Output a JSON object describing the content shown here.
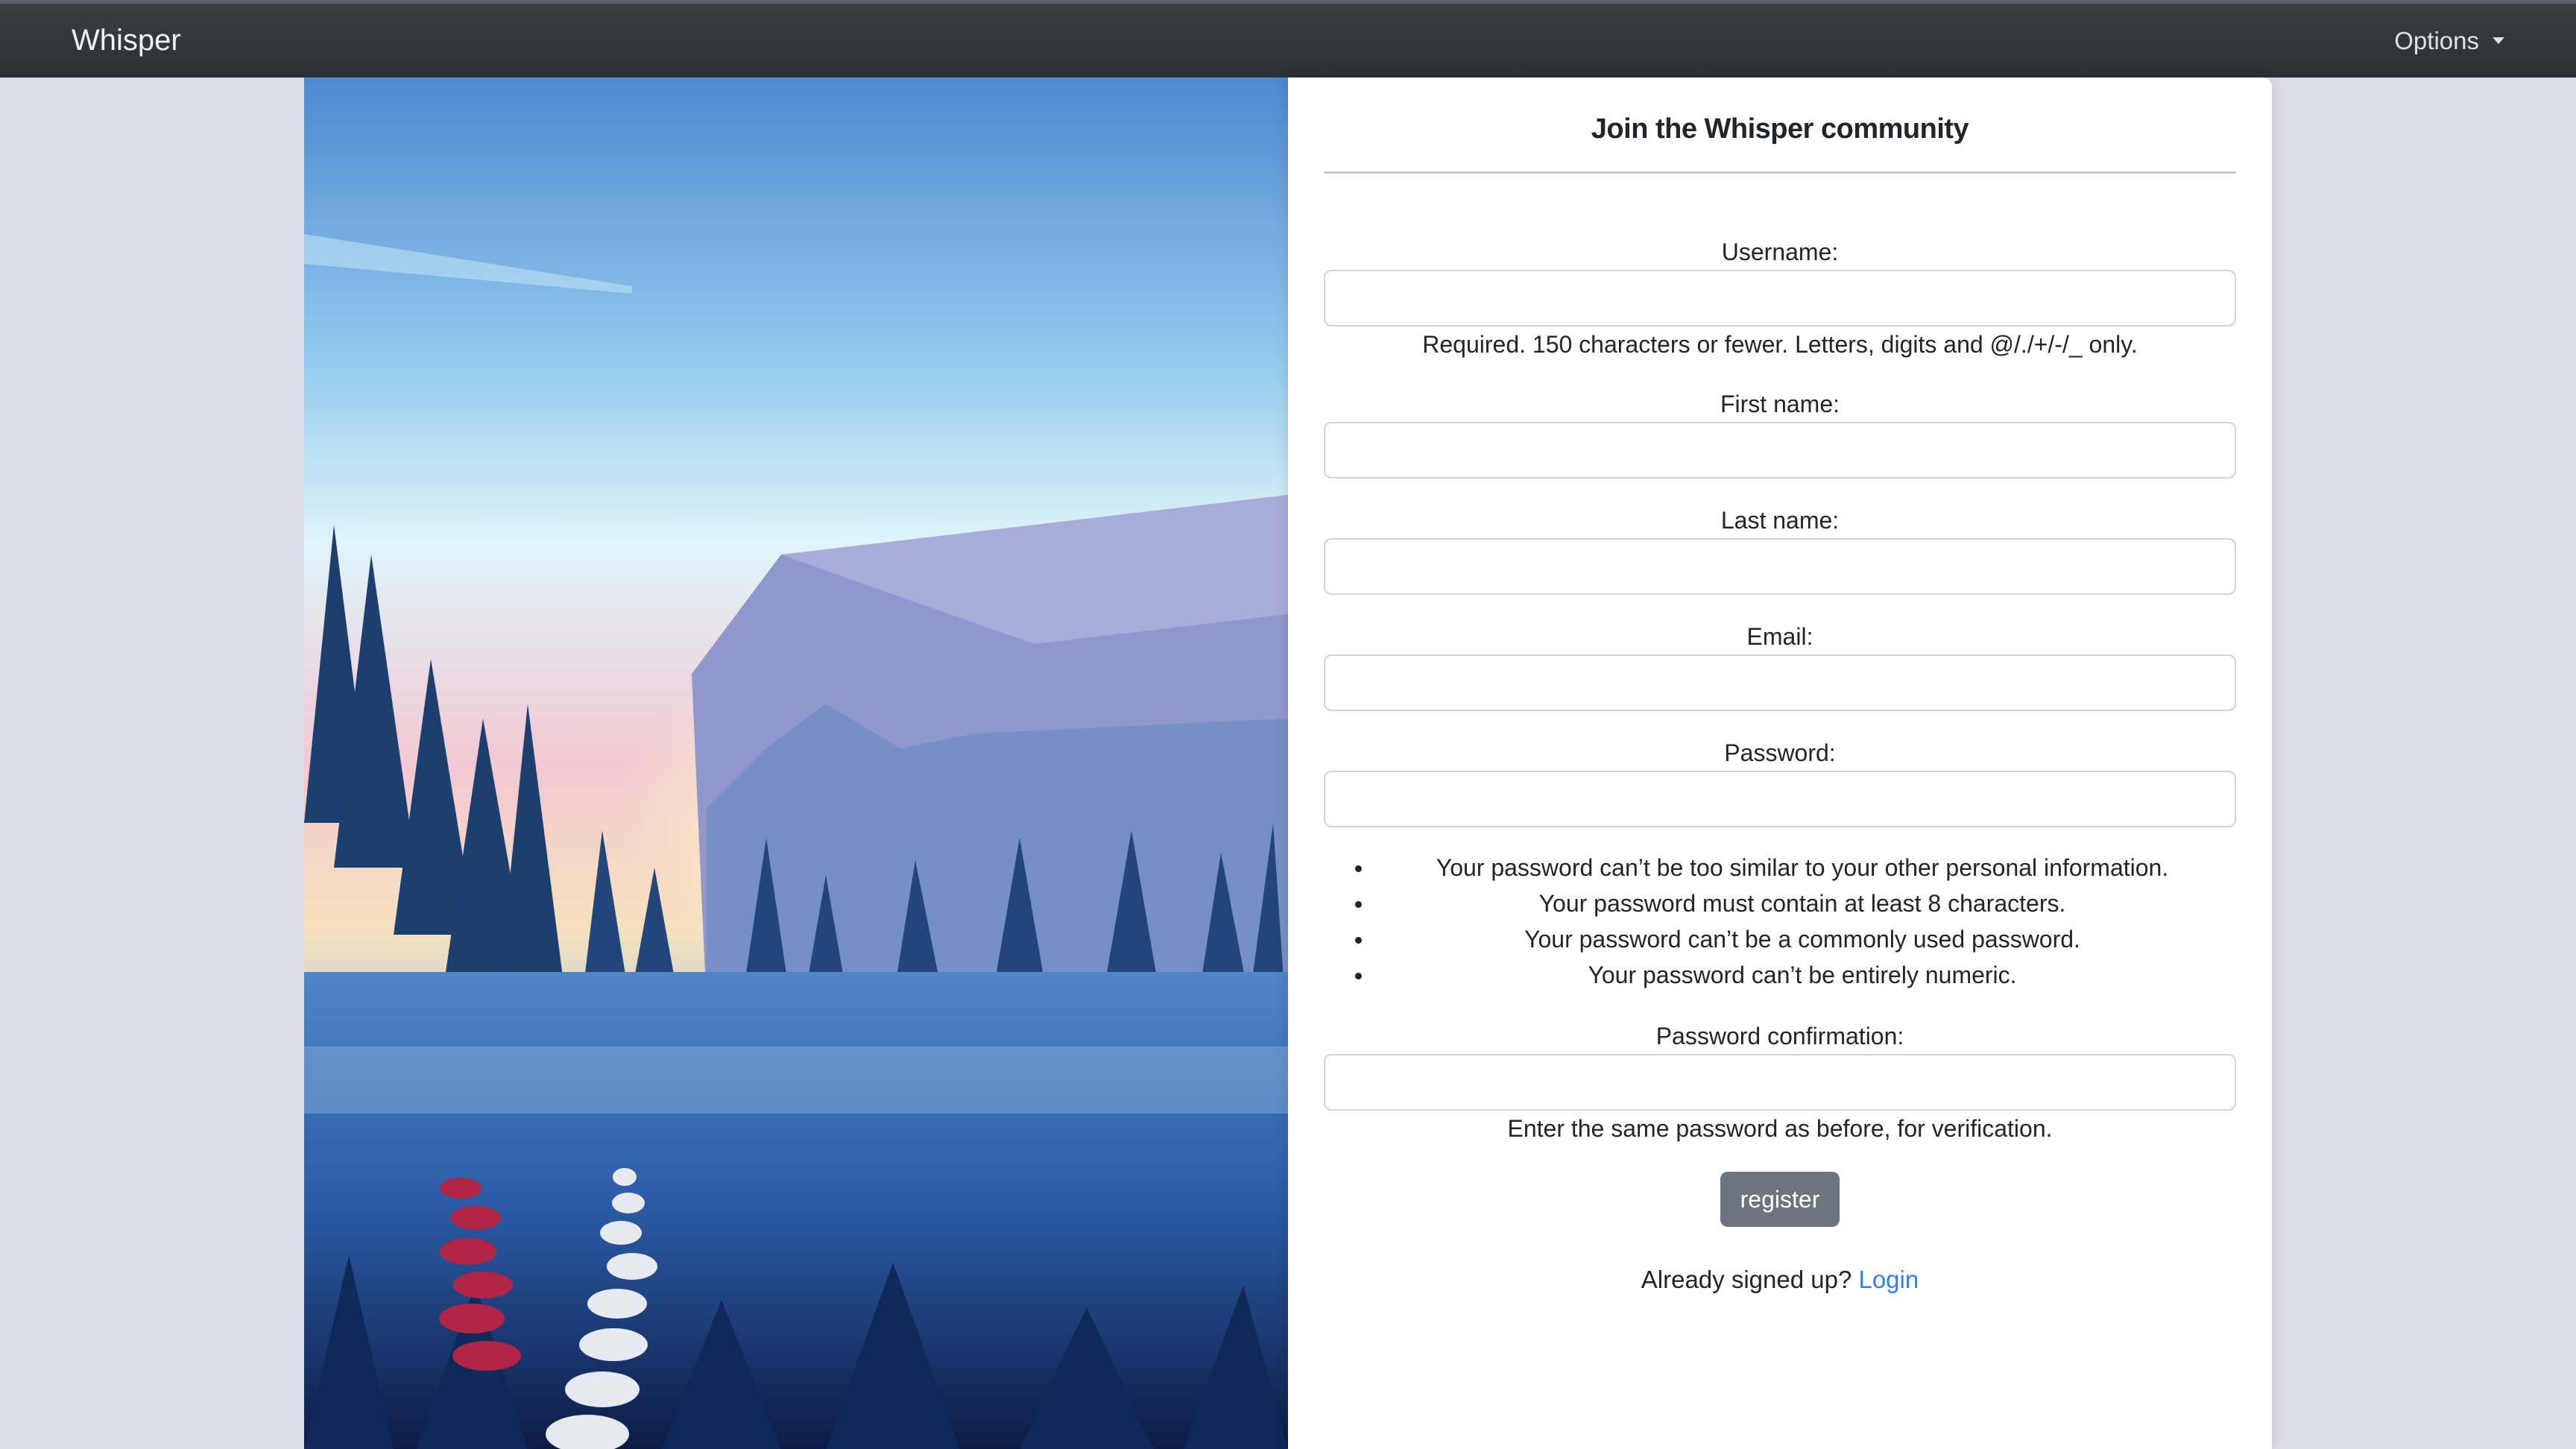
{
  "navbar": {
    "brand": "Whisper",
    "options_label": "Options"
  },
  "form": {
    "title": "Join the Whisper community",
    "username_label": "Username:",
    "username_help": "Required. 150 characters or fewer. Letters, digits and @/./+/-/_ only.",
    "first_name_label": "First name:",
    "last_name_label": "Last name:",
    "email_label": "Email:",
    "password_label": "Password:",
    "password_rules": [
      "Your password can’t be too similar to your other personal information.",
      "Your password must contain at least 8 characters.",
      "Your password can’t be a commonly used password.",
      "Your password can’t be entirely numeric."
    ],
    "confirm_label": "Password confirmation:",
    "confirm_help": "Enter the same password as before, for verification.",
    "submit_label": "register",
    "signin_prompt": "Already signed up?",
    "signin_link": "Login"
  }
}
